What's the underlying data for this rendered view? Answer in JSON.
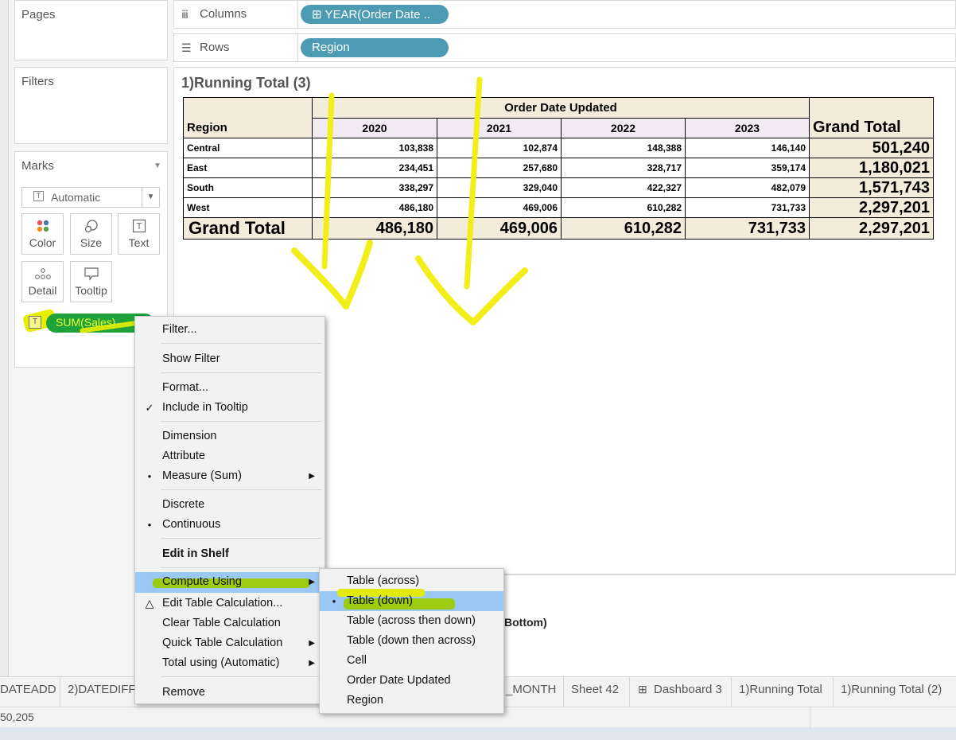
{
  "left": {
    "pages_title": "Pages",
    "filters_title": "Filters",
    "marks_title": "Marks",
    "mark_type": "Automatic",
    "mark_buttons": [
      "Color",
      "Size",
      "Text",
      "Detail",
      "Tooltip"
    ],
    "sum_pill": "SUM(Sales)"
  },
  "shelves": {
    "columns_label": "Columns",
    "columns_pill": "⊞ YEAR(Order Date ..",
    "rows_label": "Rows",
    "rows_pill": "Region"
  },
  "sheet": {
    "title": "1)Running Total (3)",
    "crosstab": {
      "group_header": "Order Date Updated",
      "row_header": "Region",
      "years": [
        "2020",
        "2021",
        "2022",
        "2023"
      ],
      "grand_total_label": "Grand Total",
      "rows": [
        {
          "region": "Central",
          "values": [
            "103,838",
            "102,874",
            "148,388",
            "146,140"
          ],
          "total": "501,240"
        },
        {
          "region": "East",
          "values": [
            "234,451",
            "257,680",
            "328,717",
            "359,174"
          ],
          "total": "1,180,021"
        },
        {
          "region": "South",
          "values": [
            "338,297",
            "329,040",
            "422,327",
            "482,079"
          ],
          "total": "1,571,743"
        },
        {
          "region": "West",
          "values": [
            "486,180",
            "469,006",
            "610,282",
            "731,733"
          ],
          "total": "2,297,201"
        }
      ],
      "grand_totals": [
        "486,180",
        "469,006",
        "610,282",
        "731,733"
      ],
      "grand_total_total": "2,297,201"
    }
  },
  "context_menu": {
    "filter": "Filter...",
    "show_filter": "Show Filter",
    "format": "Format...",
    "include_tooltip": "Include in Tooltip",
    "dimension": "Dimension",
    "attribute": "Attribute",
    "measure": "Measure (Sum)",
    "discrete": "Discrete",
    "continuous": "Continuous",
    "edit_in_shelf": "Edit in Shelf",
    "compute_using": "Compute Using",
    "edit_table_calc": "Edit Table Calculation...",
    "clear_table_calc": "Clear Table Calculation",
    "quick_table_calc": "Quick Table Calculation",
    "total_using": "Total using (Automatic)",
    "remove": "Remove"
  },
  "submenu": {
    "items": [
      "Table (across)",
      "Table (down)",
      "Table (across then down)",
      "Table (down then across)",
      "Cell",
      "Order Date Updated",
      "Region"
    ]
  },
  "behind_text": "Bottom)",
  "tabs": [
    "DATEADD",
    "2)DATEDIFF",
    "_MONTH",
    "Sheet 42",
    "Dashboard 3",
    "1)Running Total",
    "1)Running Total (2)"
  ],
  "status_text": "50,205",
  "colors": {
    "highlight": "#e8ee00",
    "pill_blue": "#4c9bb3",
    "pill_green": "#1fa23c",
    "menu_selected": "#99c9f4"
  }
}
